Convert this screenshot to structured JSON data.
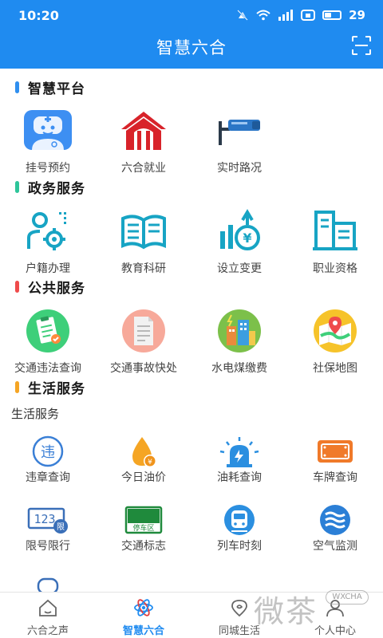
{
  "status": {
    "time": "10:20",
    "battery": "29"
  },
  "header": {
    "title": "智慧六合"
  },
  "sections": {
    "platform": {
      "title": "智慧平台",
      "color": "#2f8fef",
      "items": [
        {
          "label": "挂号预约",
          "icon": "doctor-icon"
        },
        {
          "label": "六合就业",
          "icon": "house-arch-icon"
        },
        {
          "label": "实时路况",
          "icon": "traffic-camera-icon"
        }
      ]
    },
    "government": {
      "title": "政务服务",
      "color": "#2ec59a",
      "items": [
        {
          "label": "户籍办理",
          "icon": "user-gear-icon"
        },
        {
          "label": "教育科研",
          "icon": "open-book-icon"
        },
        {
          "label": "设立变更",
          "icon": "yuan-growth-icon"
        },
        {
          "label": "职业资格",
          "icon": "building-doc-icon"
        }
      ]
    },
    "public": {
      "title": "公共服务",
      "color": "#ef4b4b",
      "items": [
        {
          "label": "交通违法查询",
          "icon": "clipboard-check-icon"
        },
        {
          "label": "交通事故快处",
          "icon": "document-icon"
        },
        {
          "label": "水电煤缴费",
          "icon": "city-power-icon"
        },
        {
          "label": "社保地图",
          "icon": "map-pin-icon"
        }
      ]
    },
    "life": {
      "title": "生活服务",
      "subtitle": "生活服务",
      "color": "#f5a524",
      "items": [
        {
          "label": "违章查询",
          "icon": "violation-icon"
        },
        {
          "label": "今日油价",
          "icon": "oil-drop-icon"
        },
        {
          "label": "油耗查询",
          "icon": "siren-icon"
        },
        {
          "label": "车牌查询",
          "icon": "license-plate-icon"
        },
        {
          "label": "限号限行",
          "icon": "restriction-plate-icon"
        },
        {
          "label": "交通标志",
          "icon": "parking-sign-icon"
        },
        {
          "label": "列车时刻",
          "icon": "train-icon"
        },
        {
          "label": "空气监测",
          "icon": "wind-icon"
        }
      ]
    }
  },
  "icon_texts": {
    "violation": "违",
    "restriction_plate": "123",
    "restriction_badge": "限",
    "parking": "停车区",
    "yuan": "¥"
  },
  "bottom_nav": [
    {
      "label": "六合之声",
      "icon": "home-icon",
      "active": false
    },
    {
      "label": "智慧六合",
      "icon": "atom-icon",
      "active": true
    },
    {
      "label": "同城生活",
      "icon": "location-icon",
      "active": false
    },
    {
      "label": "个人中心",
      "icon": "person-icon",
      "active": false
    }
  ],
  "watermark": {
    "text": "微茶",
    "badge": "WXCHA"
  }
}
